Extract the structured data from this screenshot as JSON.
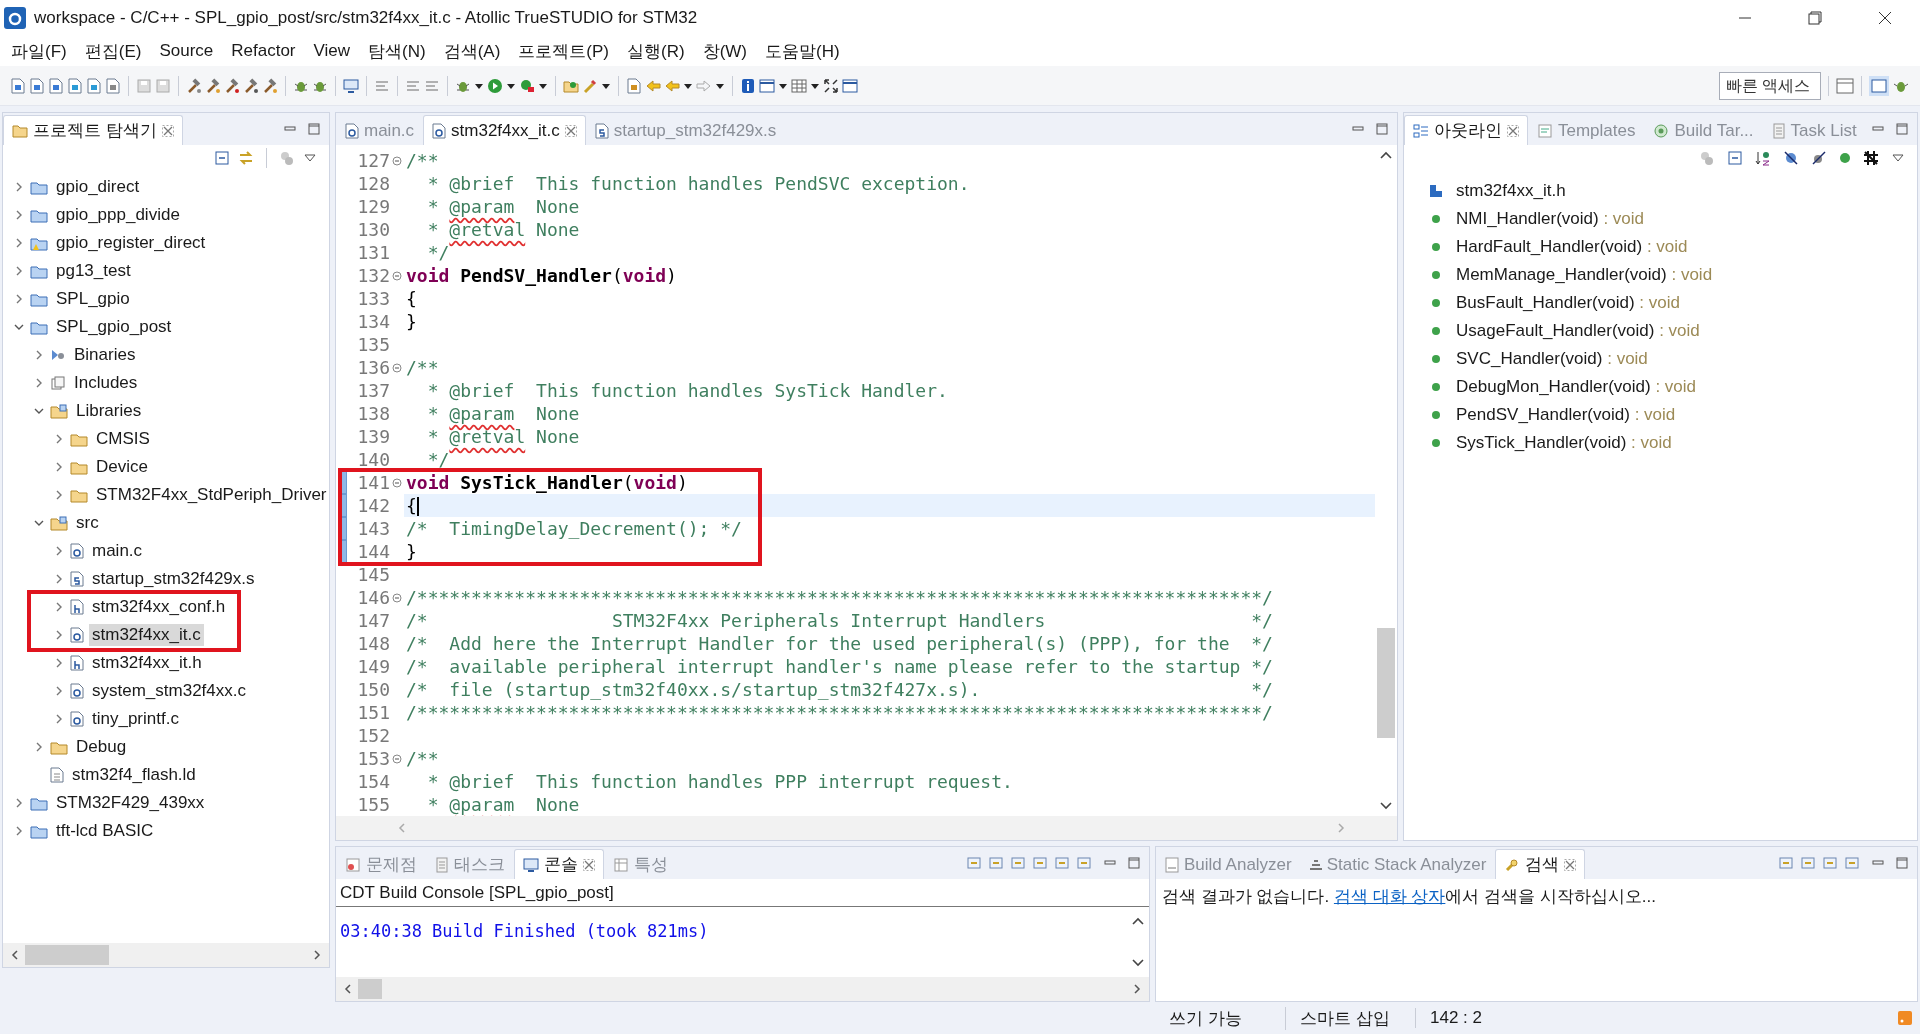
{
  "window": {
    "title": "workspace - C/C++ - SPL_gpio_post/src/stm32f4xx_it.c - Atollic TrueSTUDIO for STM32"
  },
  "menu": [
    "파일(F)",
    "편집(E)",
    "Source",
    "Refactor",
    "View",
    "탐색(N)",
    "검색(A)",
    "프로젝트(P)",
    "실행(R)",
    "창(W)",
    "도움말(H)"
  ],
  "quick_access": {
    "placeholder": "빠른 액세스"
  },
  "explorer": {
    "tab": {
      "label": "프로젝트 탐색기",
      "selected": true
    },
    "tree": [
      {
        "label": "gpio_direct",
        "kind": "project",
        "expanded": false,
        "selected": false,
        "outlined": false
      },
      {
        "label": "gpio_ppp_divide",
        "kind": "project",
        "expanded": false,
        "selected": false,
        "outlined": false
      },
      {
        "label": "gpio_register_direct",
        "kind": "project-warning",
        "expanded": false,
        "selected": false,
        "outlined": false
      },
      {
        "label": "pg13_test",
        "kind": "project",
        "expanded": false,
        "selected": false,
        "outlined": false
      },
      {
        "label": "SPL_gpio",
        "kind": "project",
        "expanded": false,
        "selected": false,
        "outlined": false
      },
      {
        "label": "SPL_gpio_post",
        "kind": "project",
        "expanded": true,
        "selected": false,
        "outlined": false,
        "children": [
          {
            "label": "Binaries",
            "kind": "binaries",
            "expanded": false,
            "selected": false,
            "outlined": false
          },
          {
            "label": "Includes",
            "kind": "includes",
            "expanded": false,
            "selected": false,
            "outlined": false
          },
          {
            "label": "Libraries",
            "kind": "source-folder",
            "expanded": true,
            "selected": false,
            "outlined": false,
            "children": [
              {
                "label": "CMSIS",
                "kind": "folder",
                "expanded": false,
                "selected": false,
                "outlined": false
              },
              {
                "label": "Device",
                "kind": "folder",
                "expanded": false,
                "selected": false,
                "outlined": false
              },
              {
                "label": "STM32F4xx_StdPeriph_Driver",
                "kind": "folder",
                "expanded": false,
                "selected": false,
                "outlined": false
              }
            ]
          },
          {
            "label": "src",
            "kind": "source-folder",
            "expanded": true,
            "selected": false,
            "outlined": false,
            "children": [
              {
                "label": "main.c",
                "kind": "c-file",
                "expanded": false,
                "selected": false,
                "outlined": false
              },
              {
                "label": "startup_stm32f429x.s",
                "kind": "s-file",
                "expanded": false,
                "selected": false,
                "outlined": false
              },
              {
                "label": "stm32f4xx_conf.h",
                "kind": "h-file",
                "expanded": false,
                "selected": false,
                "outlined": true
              },
              {
                "label": "stm32f4xx_it.c",
                "kind": "c-file",
                "expanded": false,
                "selected": true,
                "outlined": true
              },
              {
                "label": "stm32f4xx_it.h",
                "kind": "h-file",
                "expanded": false,
                "selected": false,
                "outlined": false
              },
              {
                "label": "system_stm32f4xx.c",
                "kind": "c-file",
                "expanded": false,
                "selected": false,
                "outlined": false
              },
              {
                "label": "tiny_printf.c",
                "kind": "c-file",
                "expanded": false,
                "selected": false,
                "outlined": false
              }
            ]
          },
          {
            "label": "Debug",
            "kind": "folder",
            "expanded": false,
            "selected": false,
            "outlined": false
          },
          {
            "label": "stm32f4_flash.ld",
            "kind": "ld-file",
            "selected": false,
            "outlined": false
          }
        ]
      },
      {
        "label": "STM32F429_439xx",
        "kind": "project",
        "expanded": false,
        "selected": false,
        "outlined": false
      },
      {
        "label": "tft-lcd BASIC",
        "kind": "project",
        "expanded": false,
        "selected": false,
        "outlined": false
      }
    ]
  },
  "editor": {
    "tabs": [
      {
        "label": "main.c",
        "kind": "c-file",
        "selected": false
      },
      {
        "label": "stm32f4xx_it.c",
        "kind": "c-file",
        "selected": true
      },
      {
        "label": "startup_stm32f429x.s",
        "kind": "s-file",
        "selected": false
      }
    ],
    "lines": [
      {
        "number": "127",
        "fold": true,
        "current": false,
        "changed": false,
        "outlined": false,
        "segments": [
          {
            "kind": "comment",
            "text": "/**"
          }
        ]
      },
      {
        "number": "128",
        "fold": false,
        "current": false,
        "changed": false,
        "outlined": false,
        "segments": [
          {
            "kind": "comment",
            "text": "  * @brief  This function handles PendSVC exception."
          }
        ]
      },
      {
        "number": "129",
        "fold": false,
        "current": false,
        "changed": false,
        "outlined": false,
        "segments": [
          {
            "kind": "comment",
            "text": "  * "
          },
          {
            "kind": "flagged",
            "text": "@param"
          },
          {
            "kind": "comment",
            "text": "  None"
          }
        ]
      },
      {
        "number": "130",
        "fold": false,
        "current": false,
        "changed": false,
        "outlined": false,
        "segments": [
          {
            "kind": "comment",
            "text": "  * "
          },
          {
            "kind": "flagged",
            "text": "@retval"
          },
          {
            "kind": "comment",
            "text": " None"
          }
        ]
      },
      {
        "number": "131",
        "fold": false,
        "current": false,
        "changed": false,
        "outlined": false,
        "segments": [
          {
            "kind": "comment",
            "text": "  */"
          }
        ]
      },
      {
        "number": "132",
        "fold": true,
        "current": false,
        "changed": false,
        "outlined": false,
        "segments": [
          {
            "kind": "keyword",
            "text": "void "
          },
          {
            "kind": "name",
            "text": "PendSV_Handler"
          },
          {
            "kind": "plain",
            "text": "("
          },
          {
            "kind": "keyword",
            "text": "void"
          },
          {
            "kind": "plain",
            "text": ")"
          }
        ]
      },
      {
        "number": "133",
        "fold": false,
        "current": false,
        "changed": false,
        "outlined": false,
        "segments": [
          {
            "kind": "plain",
            "text": "{"
          }
        ]
      },
      {
        "number": "134",
        "fold": false,
        "current": false,
        "changed": false,
        "outlined": false,
        "segments": [
          {
            "kind": "plain",
            "text": "}"
          }
        ]
      },
      {
        "number": "135",
        "fold": false,
        "current": false,
        "changed": false,
        "outlined": false
      },
      {
        "number": "136",
        "fold": true,
        "current": false,
        "changed": false,
        "outlined": false,
        "segments": [
          {
            "kind": "comment",
            "text": "/**"
          }
        ]
      },
      {
        "number": "137",
        "fold": false,
        "current": false,
        "changed": false,
        "outlined": false,
        "segments": [
          {
            "kind": "comment",
            "text": "  * @brief  This function handles SysTick Handler."
          }
        ]
      },
      {
        "number": "138",
        "fold": false,
        "current": false,
        "changed": false,
        "outlined": false,
        "segments": [
          {
            "kind": "comment",
            "text": "  * "
          },
          {
            "kind": "flagged",
            "text": "@param"
          },
          {
            "kind": "comment",
            "text": "  None"
          }
        ]
      },
      {
        "number": "139",
        "fold": false,
        "current": false,
        "changed": false,
        "outlined": false,
        "segments": [
          {
            "kind": "comment",
            "text": "  * "
          },
          {
            "kind": "flagged",
            "text": "@retval"
          },
          {
            "kind": "comment",
            "text": " None"
          }
        ]
      },
      {
        "number": "140",
        "fold": false,
        "current": false,
        "changed": false,
        "outlined": false,
        "segments": [
          {
            "kind": "comment",
            "text": "  */"
          }
        ]
      },
      {
        "number": "141",
        "fold": true,
        "current": false,
        "changed": true,
        "outlined": true,
        "segments": [
          {
            "kind": "keyword",
            "text": "void "
          },
          {
            "kind": "name",
            "text": "SysTick_Handler"
          },
          {
            "kind": "plain",
            "text": "("
          },
          {
            "kind": "keyword",
            "text": "void"
          },
          {
            "kind": "plain",
            "text": ")"
          }
        ]
      },
      {
        "number": "142",
        "fold": false,
        "current": true,
        "changed": true,
        "outlined": true,
        "segments": [
          {
            "kind": "plain",
            "text": "{"
          }
        ]
      },
      {
        "number": "143",
        "fold": false,
        "current": false,
        "changed": true,
        "outlined": true,
        "segments": [
          {
            "kind": "comment",
            "text": "/*  TimingDelay_Decrement(); */"
          }
        ]
      },
      {
        "number": "144",
        "fold": false,
        "current": false,
        "changed": true,
        "outlined": true,
        "segments": [
          {
            "kind": "plain",
            "text": "}"
          }
        ]
      },
      {
        "number": "145",
        "fold": false,
        "current": false,
        "changed": false,
        "outlined": false
      },
      {
        "number": "146",
        "fold": true,
        "current": false,
        "changed": false,
        "outlined": false,
        "segments": [
          {
            "kind": "comment",
            "text": "/******************************************************************************/"
          }
        ]
      },
      {
        "number": "147",
        "fold": false,
        "current": false,
        "changed": false,
        "outlined": false,
        "segments": [
          {
            "kind": "comment",
            "text": "/*                 STM32F4xx Peripherals Interrupt Handlers                   */"
          }
        ]
      },
      {
        "number": "148",
        "fold": false,
        "current": false,
        "changed": false,
        "outlined": false,
        "segments": [
          {
            "kind": "comment",
            "text": "/*  Add here the Interrupt Handler for the used peripheral(s) (PPP), for the  */"
          }
        ]
      },
      {
        "number": "149",
        "fold": false,
        "current": false,
        "changed": false,
        "outlined": false,
        "segments": [
          {
            "kind": "comment",
            "text": "/*  available peripheral interrupt handler's name please refer to the startup */"
          }
        ]
      },
      {
        "number": "150",
        "fold": false,
        "current": false,
        "changed": false,
        "outlined": false,
        "segments": [
          {
            "kind": "comment",
            "text": "/*  file (startup_stm32f40xx.s/startup_stm32f427x.s).                         */"
          }
        ]
      },
      {
        "number": "151",
        "fold": false,
        "current": false,
        "changed": false,
        "outlined": false,
        "segments": [
          {
            "kind": "comment",
            "text": "/******************************************************************************/"
          }
        ]
      },
      {
        "number": "152",
        "fold": false,
        "current": false,
        "changed": false,
        "outlined": false
      },
      {
        "number": "153",
        "fold": true,
        "current": false,
        "changed": false,
        "outlined": false,
        "segments": [
          {
            "kind": "comment",
            "text": "/**"
          }
        ]
      },
      {
        "number": "154",
        "fold": false,
        "current": false,
        "changed": false,
        "outlined": false,
        "segments": [
          {
            "kind": "comment",
            "text": "  * @brief  This function handles PPP interrupt request."
          }
        ]
      },
      {
        "number": "155",
        "fold": false,
        "current": false,
        "changed": false,
        "outlined": false,
        "segments": [
          {
            "kind": "comment",
            "text": "  * "
          },
          {
            "kind": "flagged",
            "text": "@param"
          },
          {
            "kind": "comment",
            "text": "  None"
          }
        ]
      }
    ]
  },
  "outline": {
    "tabs": [
      {
        "label": "아웃라인",
        "kind": "outline",
        "selected": true
      },
      {
        "label": "Templates",
        "kind": "templates",
        "selected": false
      },
      {
        "label": "Build Tar...",
        "kind": "target",
        "selected": false
      },
      {
        "label": "Task List",
        "kind": "tasks",
        "selected": false
      }
    ],
    "items": [
      {
        "kind": "include",
        "name": "stm32f4xx_it.h"
      },
      {
        "kind": "function",
        "name": "NMI_Handler(void)",
        "type": ": void"
      },
      {
        "kind": "function",
        "name": "HardFault_Handler(void)",
        "type": ": void"
      },
      {
        "kind": "function",
        "name": "MemManage_Handler(void)",
        "type": ": void"
      },
      {
        "kind": "function",
        "name": "BusFault_Handler(void)",
        "type": ": void"
      },
      {
        "kind": "function",
        "name": "UsageFault_Handler(void)",
        "type": ": void"
      },
      {
        "kind": "function",
        "name": "SVC_Handler(void)",
        "type": ": void"
      },
      {
        "kind": "function",
        "name": "DebugMon_Handler(void)",
        "type": ": void"
      },
      {
        "kind": "function",
        "name": "PendSV_Handler(void)",
        "type": ": void"
      },
      {
        "kind": "function",
        "name": "SysTick_Handler(void)",
        "type": ": void"
      }
    ]
  },
  "console": {
    "tabs": [
      {
        "label": "문제점",
        "kind": "problems",
        "selected": false
      },
      {
        "label": "태스크",
        "kind": "tasks",
        "selected": false
      },
      {
        "label": "콘솔",
        "kind": "console",
        "selected": true
      },
      {
        "label": "특성",
        "kind": "properties",
        "selected": false
      }
    ],
    "header": "CDT Build Console [SPL_gpio_post]",
    "output": "03:40:38 Build Finished (took 821ms)"
  },
  "search": {
    "tabs": [
      {
        "label": "Build Analyzer",
        "kind": "analyzer",
        "selected": false
      },
      {
        "label": "Static Stack Analyzer",
        "kind": "stack",
        "selected": false
      },
      {
        "label": "검색",
        "kind": "search",
        "selected": true
      }
    ],
    "message_before": "검색 결과가 없습니다. ",
    "message_link": "검색 대화 상자",
    "message_after": "에서 검색을 시작하십시오..."
  },
  "status_bar": [
    "쓰기 가능",
    "스마트 삽입",
    "142 : 2"
  ]
}
